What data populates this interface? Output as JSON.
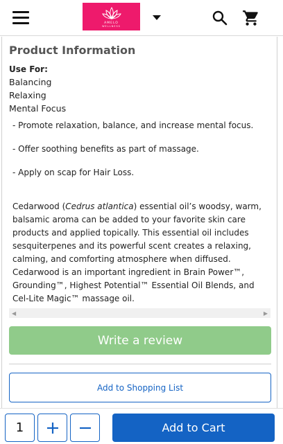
{
  "header": {
    "logo_text": "AMELO",
    "logo_subtext": "WELLNESS",
    "brand_color": "#ee1a6c",
    "icons": [
      "menu-icon",
      "chevron-down-icon",
      "search-icon",
      "cart-icon"
    ]
  },
  "product_info": {
    "title": "Product Information",
    "use_for_label": "Use For:",
    "use_for": [
      "Balancing",
      "Relaxing",
      "Mental Focus"
    ],
    "bullets": [
      " - Promote relaxation, balance, and increase mental focus.",
      " - Offer soothing benefits as part of massage.",
      " - Apply on scap for Hair Loss."
    ],
    "description_prefix": "Cedarwood (",
    "description_italic": "Cedrus atlantica",
    "description_suffix": ") essential oil’s woodsy, warm, balsamic aroma can be added to your favorite skin care products and applied topically. This essential oil includes sesquiterpenes and its powerful scent creates a relaxing, calming, and comforting atmosphere when diffused. Cedarwood is an important ingredient in Brain Power™, Grounding™, Highest Potential™ Essential Oil Blends, and Cel-Lite Magic™ massage oil."
  },
  "actions": {
    "write_review": "Write a review",
    "add_to_shopping_list": "Add to Shopping List"
  },
  "bottom_bar": {
    "quantity": "1",
    "add_to_cart": "Add to Cart",
    "accent_color": "#1463c4"
  }
}
